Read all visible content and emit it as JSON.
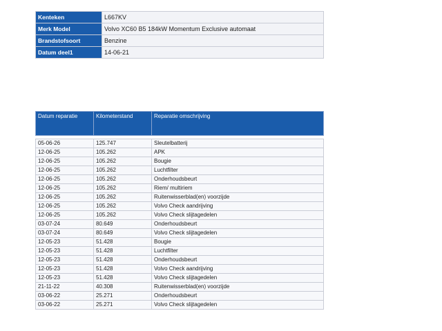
{
  "vehicle": {
    "rows": [
      {
        "label": "Kenteken",
        "value": "L667KV"
      },
      {
        "label": "Merk Model",
        "value": "Volvo XC60 B5 184kW Momentum Exclusive automaat"
      },
      {
        "label": "Brandstofsoort",
        "value": "Benzine"
      },
      {
        "label": "Datum deel1",
        "value": "14-06-21"
      }
    ]
  },
  "repairs": {
    "headers": {
      "date": "Datum reparatie",
      "km": "Kilometerstand",
      "desc": "Reparatie omschrijving"
    },
    "rows": [
      {
        "date": "05-06-26",
        "km": "125.747",
        "desc": "Sleutelbatterij"
      },
      {
        "date": "12-06-25",
        "km": "105.262",
        "desc": "APK"
      },
      {
        "date": "12-06-25",
        "km": "105.262",
        "desc": "Bougie"
      },
      {
        "date": "12-06-25",
        "km": "105.262",
        "desc": "Luchtfilter"
      },
      {
        "date": "12-06-25",
        "km": "105.262",
        "desc": "Onderhoudsbeurt"
      },
      {
        "date": "12-06-25",
        "km": "105.262",
        "desc": "Riem/ multiriem"
      },
      {
        "date": "12-06-25",
        "km": "105.262",
        "desc": "Ruitenwisserblad(en) voorzijde"
      },
      {
        "date": "12-06-25",
        "km": "105.262",
        "desc": "Volvo Check aandrijving"
      },
      {
        "date": "12-06-25",
        "km": "105.262",
        "desc": "Volvo Check slijtagedelen"
      },
      {
        "date": "03-07-24",
        "km": "80.649",
        "desc": "Onderhoudsbeurt"
      },
      {
        "date": "03-07-24",
        "km": "80.649",
        "desc": "Volvo Check slijtagedelen"
      },
      {
        "date": "12-05-23",
        "km": "51.428",
        "desc": "Bougie"
      },
      {
        "date": "12-05-23",
        "km": "51.428",
        "desc": "Luchtfilter"
      },
      {
        "date": "12-05-23",
        "km": "51.428",
        "desc": "Onderhoudsbeurt"
      },
      {
        "date": "12-05-23",
        "km": "51.428",
        "desc": "Volvo Check aandrijving"
      },
      {
        "date": "12-05-23",
        "km": "51.428",
        "desc": "Volvo Check slijtagedelen"
      },
      {
        "date": "21-11-22",
        "km": "40.308",
        "desc": "Ruitenwisserblad(en) voorzijde"
      },
      {
        "date": "03-06-22",
        "km": "25.271",
        "desc": "Onderhoudsbeurt"
      },
      {
        "date": "03-06-22",
        "km": "25.271",
        "desc": "Volvo Check slijtagedelen"
      }
    ]
  }
}
